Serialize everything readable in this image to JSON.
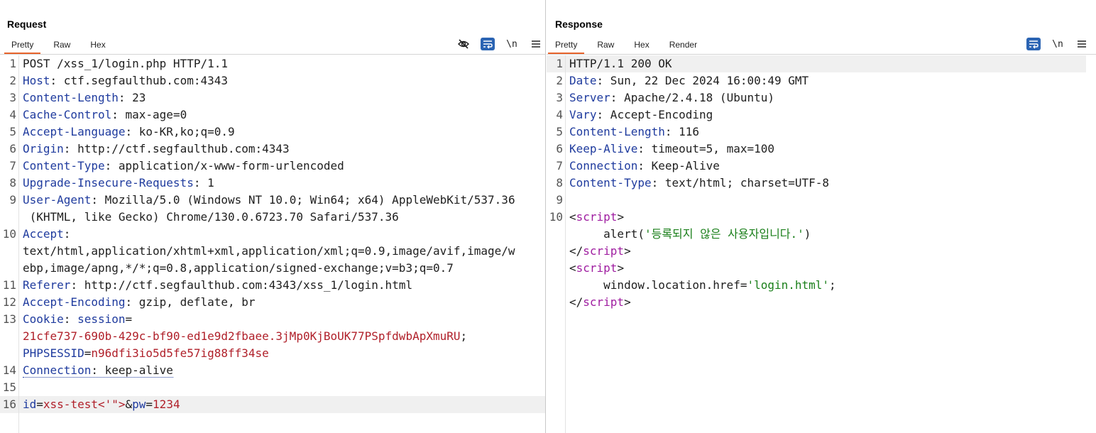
{
  "request": {
    "title": "Request",
    "tabs": [
      "Pretty",
      "Raw",
      "Hex"
    ],
    "active_tab": "Pretty",
    "toolbar": {
      "newline_label": "\\n"
    },
    "lines": {
      "l1": "POST /xss_1/login.php HTTP/1.1",
      "l2k": "Host",
      "l2v": " ctf.segfaulthub.com:4343",
      "l3k": "Content-Length",
      "l3v": " 23",
      "l4k": "Cache-Control",
      "l4v": " max-age=0",
      "l5k": "Accept-Language",
      "l5v": " ko-KR,ko;q=0.9",
      "l6k": "Origin",
      "l6v": " http://ctf.segfaulthub.com:4343",
      "l7k": "Content-Type",
      "l7v": " application/x-www-form-urlencoded",
      "l8k": "Upgrade-Insecure-Requests",
      "l8v": " 1",
      "l9k": "User-Agent",
      "l9v": " Mozilla/5.0 (Windows NT 10.0; Win64; x64) AppleWebKit/537.36",
      "l9b": " (KHTML, like Gecko) Chrome/130.0.6723.70 Safari/537.36",
      "l10k": "Accept",
      "l10b": "text/html,application/xhtml+xml,application/xml;q=0.9,image/avif,image/w",
      "l10c": "ebp,image/apng,*/*;q=0.8,application/signed-exchange;v=b3;q=0.7",
      "l11k": "Referer",
      "l11v": " http://ctf.segfaulthub.com:4343/xss_1/login.html",
      "l12k": "Accept-Encoding",
      "l12v": " gzip, deflate, br",
      "l13k": "Cookie",
      "l13n": "session",
      "l13b": "21cfe737-690b-429c-bf90-ed1e9d2fbaee.3jMp0KjBoUK77PSpfdwbApXmuRU",
      "l13c1": "PHPSESSID",
      "l13c2": "n96dfi3io5d5fe57ig88ff34se",
      "l14k": "Connection",
      "l14v": " keep-alive",
      "l16a": "id",
      "l16b": "xss-test<'\">",
      "l16c": "&",
      "l16d": "pw",
      "l16e": "1234"
    },
    "line_numbers": [
      "1",
      "2",
      "3",
      "4",
      "5",
      "6",
      "7",
      "8",
      "9",
      "10",
      "11",
      "12",
      "13",
      "14",
      "15",
      "16"
    ]
  },
  "response": {
    "title": "Response",
    "tabs": [
      "Pretty",
      "Raw",
      "Hex",
      "Render"
    ],
    "active_tab": "Pretty",
    "toolbar": {
      "newline_label": "\\n"
    },
    "lines": {
      "l1": "HTTP/1.1 200 OK",
      "l2k": "Date",
      "l2v": " Sun, 22 Dec 2024 16:00:49 GMT",
      "l3k": "Server",
      "l3v": " Apache/2.4.18 (Ubuntu)",
      "l4k": "Vary",
      "l4v": " Accept-Encoding",
      "l5k": "Content-Length",
      "l5v": " 116",
      "l6k": "Keep-Alive",
      "l6v": " timeout=5, max=100",
      "l7k": "Connection",
      "l7v": " Keep-Alive",
      "l8k": "Content-Type",
      "l8v": " text/html; charset=UTF-8",
      "tag_script": "script",
      "alert_fn": "     alert(",
      "alert_str": "'등록되지 않은 사용자입니다.'",
      "alert_end": ")",
      "loc_code": "     window.location.href=",
      "loc_str": "'login.html'",
      "loc_end": ";"
    },
    "line_numbers": [
      "1",
      "2",
      "3",
      "4",
      "5",
      "6",
      "7",
      "8",
      "9",
      "10"
    ]
  },
  "layout_modes": [
    "side-by-side",
    "stacked",
    "single"
  ],
  "colors": {
    "accent": "#e8642c",
    "header_name": "#1f3b9e",
    "cookie_value": "#b0202a",
    "tag": "#9f1da0",
    "string": "#1a7f1a",
    "active_toggle": "#2b64b3"
  }
}
